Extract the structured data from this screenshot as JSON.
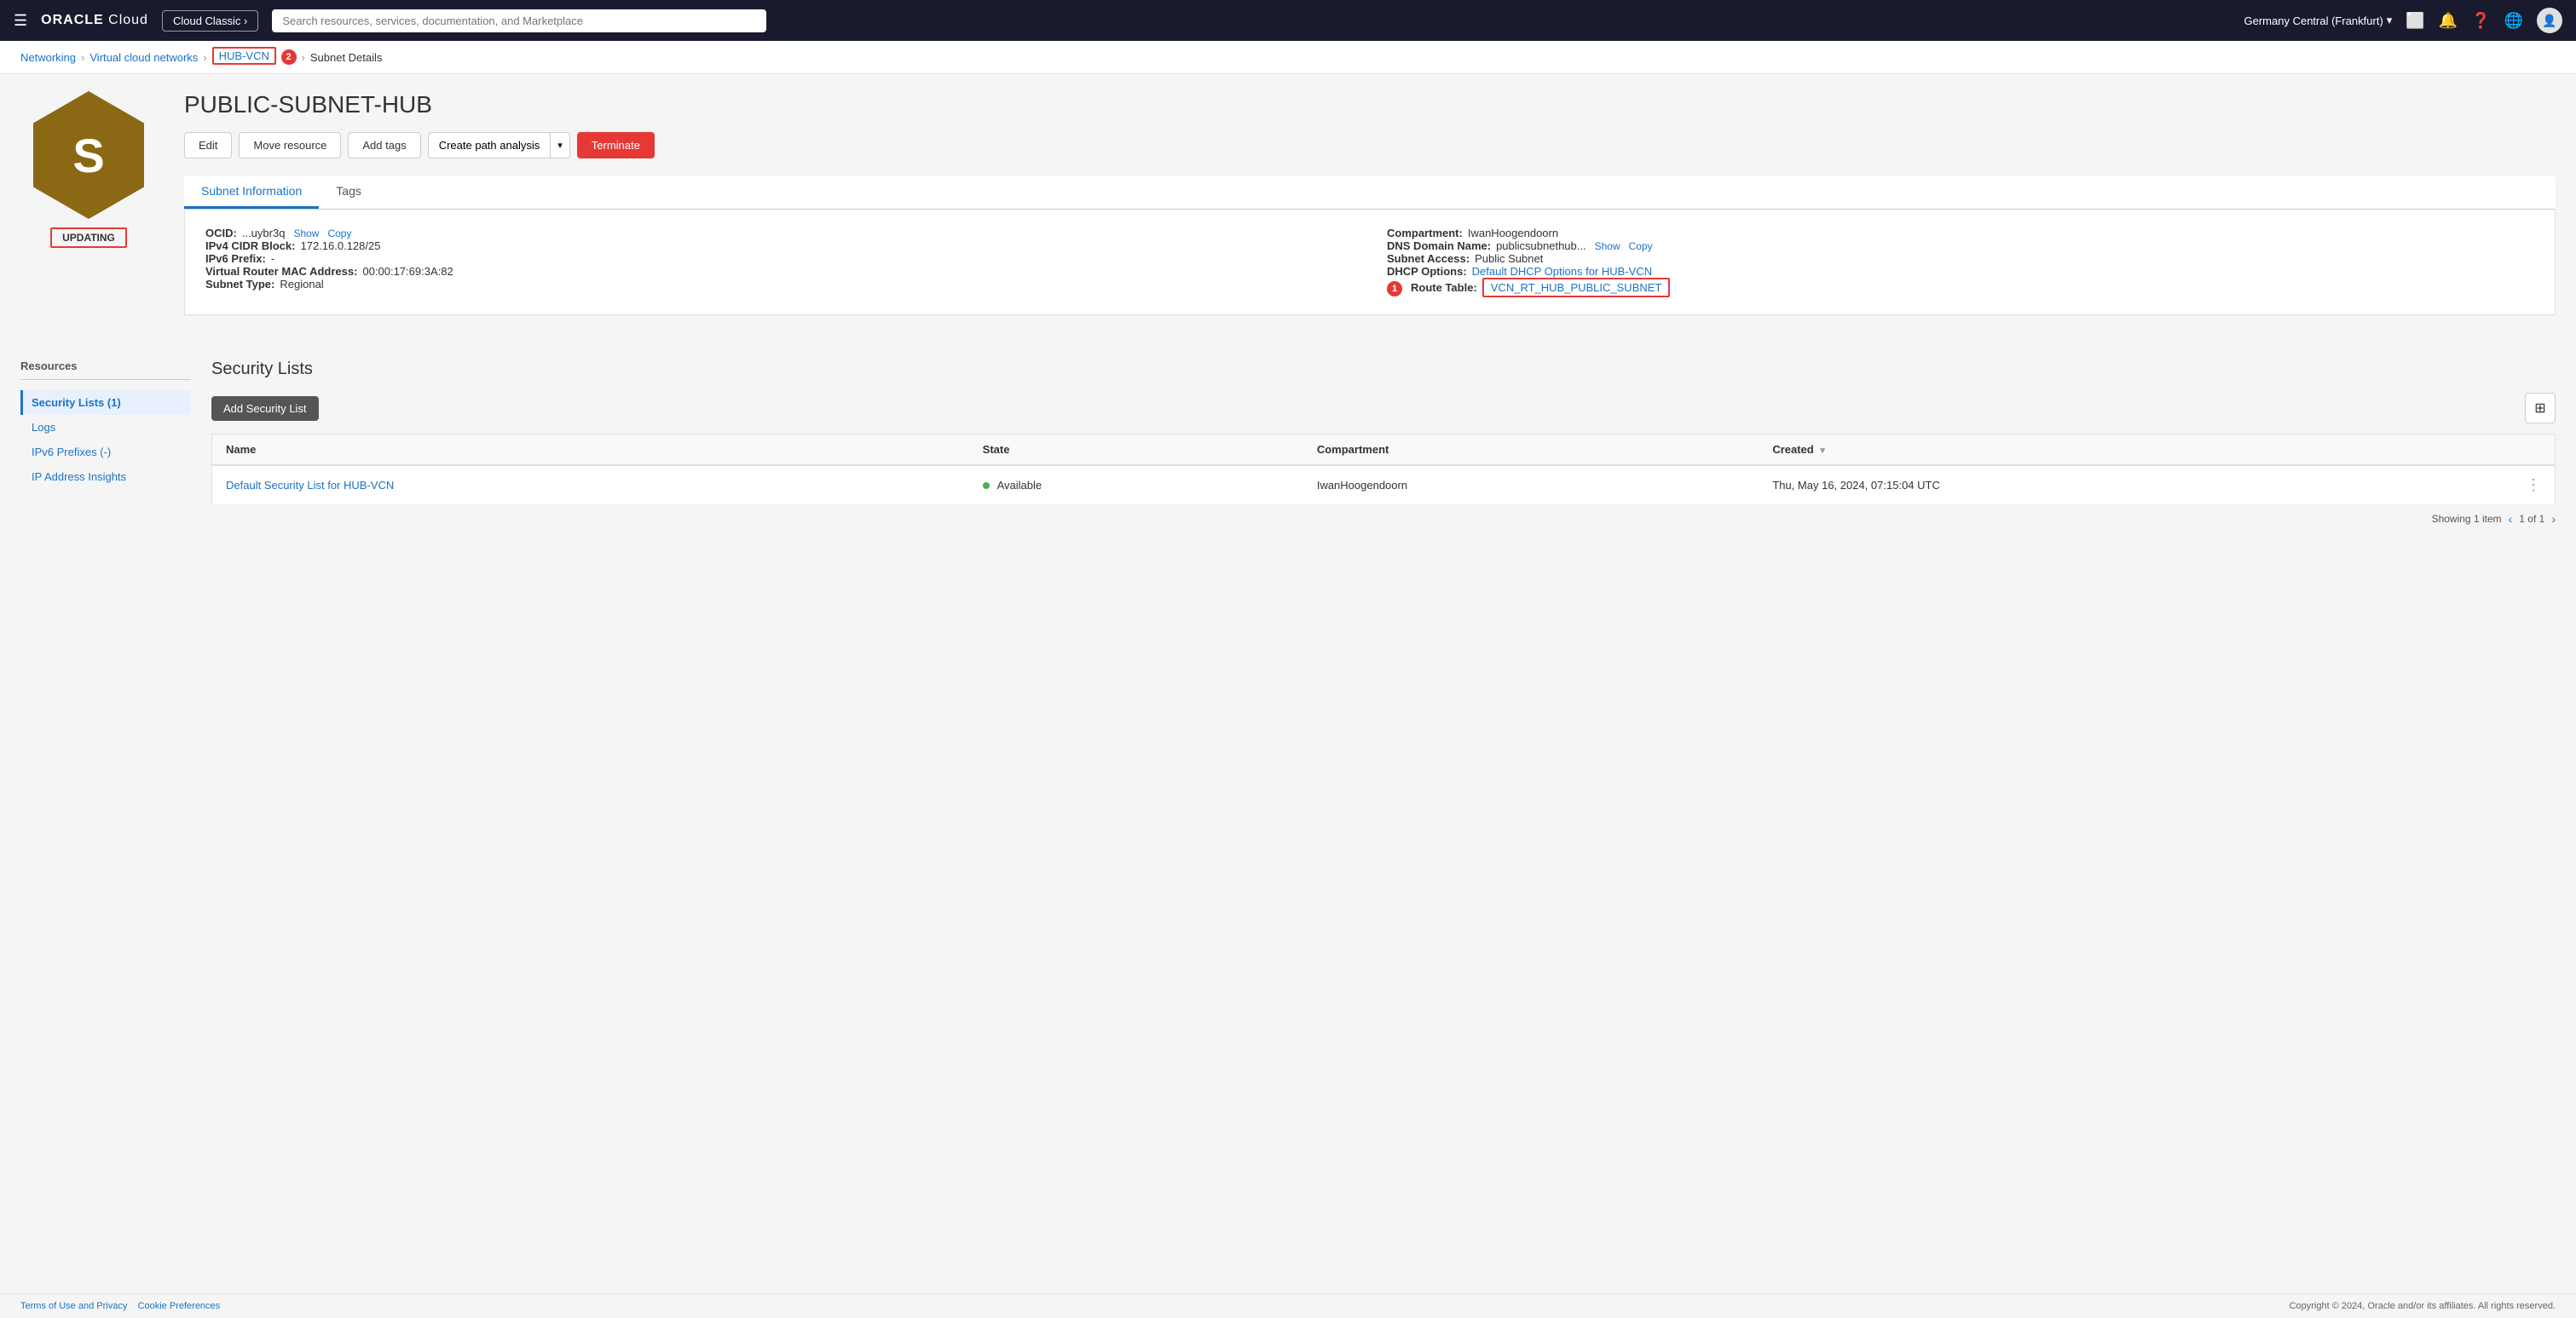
{
  "topnav": {
    "oracle_logo": "ORACLE Cloud",
    "cloud_classic_label": "Cloud Classic ›",
    "search_placeholder": "Search resources, services, documentation, and Marketplace",
    "region": "Germany Central (Frankfurt)",
    "region_chevron": "▾"
  },
  "breadcrumb": {
    "networking": "Networking",
    "virtual_cloud_networks": "Virtual cloud networks",
    "hub_vcn": "HUB-VCN",
    "subnet_details": "Subnet Details",
    "badge_number": "2"
  },
  "page": {
    "title": "PUBLIC-SUBNET-HUB",
    "icon_letter": "S",
    "status": "UPDATING"
  },
  "actions": {
    "edit": "Edit",
    "move_resource": "Move resource",
    "add_tags": "Add tags",
    "create_path_analysis": "Create path analysis",
    "terminate": "Terminate"
  },
  "tabs": {
    "subnet_information": "Subnet Information",
    "tags": "Tags"
  },
  "subnet_info": {
    "ocid_label": "OCID:",
    "ocid_value": "...uybr3q",
    "ocid_show": "Show",
    "ocid_copy": "Copy",
    "ipv4_label": "IPv4 CIDR Block:",
    "ipv4_value": "172.16.0.128/25",
    "ipv6_label": "IPv6 Prefix:",
    "ipv6_value": "-",
    "mac_label": "Virtual Router MAC Address:",
    "mac_value": "00:00:17:69:3A:82",
    "subnet_type_label": "Subnet Type:",
    "subnet_type_value": "Regional",
    "compartment_label": "Compartment:",
    "compartment_value": "IwanHoogendoorn",
    "dns_label": "DNS Domain Name:",
    "dns_value": "publicsubnethub...",
    "dns_show": "Show",
    "dns_copy": "Copy",
    "access_label": "Subnet Access:",
    "access_value": "Public Subnet",
    "dhcp_label": "DHCP Options:",
    "dhcp_value": "Default DHCP Options for HUB-VCN",
    "route_label": "Route Table:",
    "route_value": "VCN_RT_HUB_PUBLIC_SUBNET",
    "route_badge": "1"
  },
  "sidebar": {
    "title": "Resources",
    "items": [
      {
        "label": "Security Lists (1)",
        "active": true
      },
      {
        "label": "Logs",
        "active": false
      },
      {
        "label": "IPv6 Prefixes (-)",
        "active": false
      },
      {
        "label": "IP Address Insights",
        "active": false
      }
    ]
  },
  "security_lists": {
    "section_title": "Security Lists",
    "add_button": "Add Security List",
    "columns": [
      {
        "label": "Name",
        "sortable": false
      },
      {
        "label": "State",
        "sortable": false
      },
      {
        "label": "Compartment",
        "sortable": false
      },
      {
        "label": "Created",
        "sortable": true
      }
    ],
    "rows": [
      {
        "name": "Default Security List for HUB-VCN",
        "state": "Available",
        "state_color": "available",
        "compartment": "IwanHoogendoorn",
        "created": "Thu, May 16, 2024, 07:15:04 UTC"
      }
    ],
    "showing": "Showing 1 item",
    "page_info": "1 of 1"
  },
  "footer": {
    "terms": "Terms of Use and Privacy",
    "cookie": "Cookie Preferences",
    "copyright": "Copyright © 2024, Oracle and/or its affiliates. All rights reserved."
  }
}
